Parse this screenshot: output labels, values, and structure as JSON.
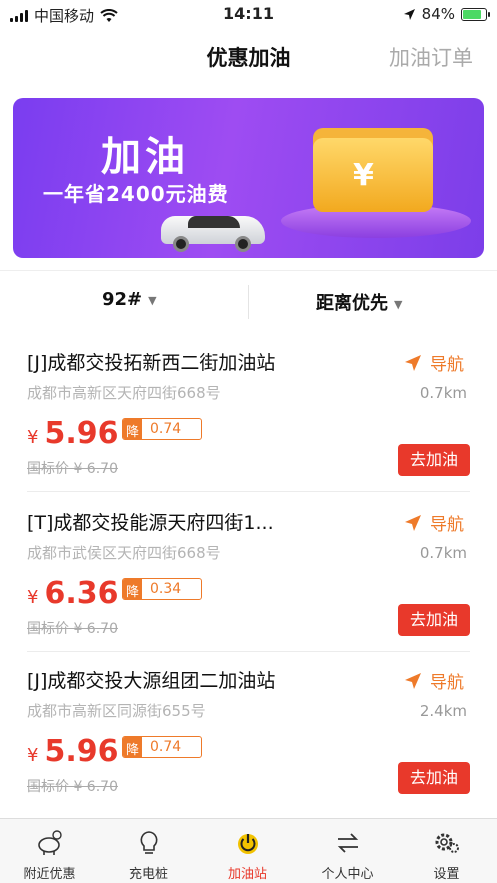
{
  "status": {
    "carrier": "中国移动",
    "time": "14:11",
    "battery": "84%"
  },
  "header": {
    "title": "优惠加油",
    "orders_label": "加油订单"
  },
  "banner": {
    "title": "加油",
    "subtitle": "一年省2400元油费",
    "currency_symbol": "¥"
  },
  "filters": {
    "fuel_type": "92#",
    "sort": "距离优先"
  },
  "stations": [
    {
      "name": "[J]成都交投拓新西二街加油站",
      "address": "成都市高新区天府四街668号",
      "nav_label": "导航",
      "distance": "0.7km",
      "currency": "¥",
      "price": "5.96",
      "discount_tag": "降",
      "discount": "0.74",
      "standard_price": "国标价 ¥ 6.70",
      "go_label": "去加油"
    },
    {
      "name": "[T]成都交投能源天府四街1...",
      "address": "成都市武侯区天府四街668号",
      "nav_label": "导航",
      "distance": "0.7km",
      "currency": "¥",
      "price": "6.36",
      "discount_tag": "降",
      "discount": "0.34",
      "standard_price": "国标价 ¥ 6.70",
      "go_label": "去加油"
    },
    {
      "name": "[J]成都交投大源组团二加油站",
      "address": "成都市高新区同源街655号",
      "nav_label": "导航",
      "distance": "2.4km",
      "currency": "¥",
      "price": "5.96",
      "discount_tag": "降",
      "discount": "0.74",
      "standard_price": "国标价 ¥ 6.70",
      "go_label": "去加油"
    }
  ],
  "tabs": [
    {
      "label": "附近优惠",
      "icon": "piggy-bank-icon"
    },
    {
      "label": "充电桩",
      "icon": "bulb-icon"
    },
    {
      "label": "加油站",
      "icon": "power-icon",
      "active": true
    },
    {
      "label": "个人中心",
      "icon": "exchange-icon"
    },
    {
      "label": "设置",
      "icon": "gear-icon"
    }
  ],
  "colors": {
    "accent": "#e8392b",
    "nav": "#ee7a2a",
    "banner": "#8e46ee"
  }
}
